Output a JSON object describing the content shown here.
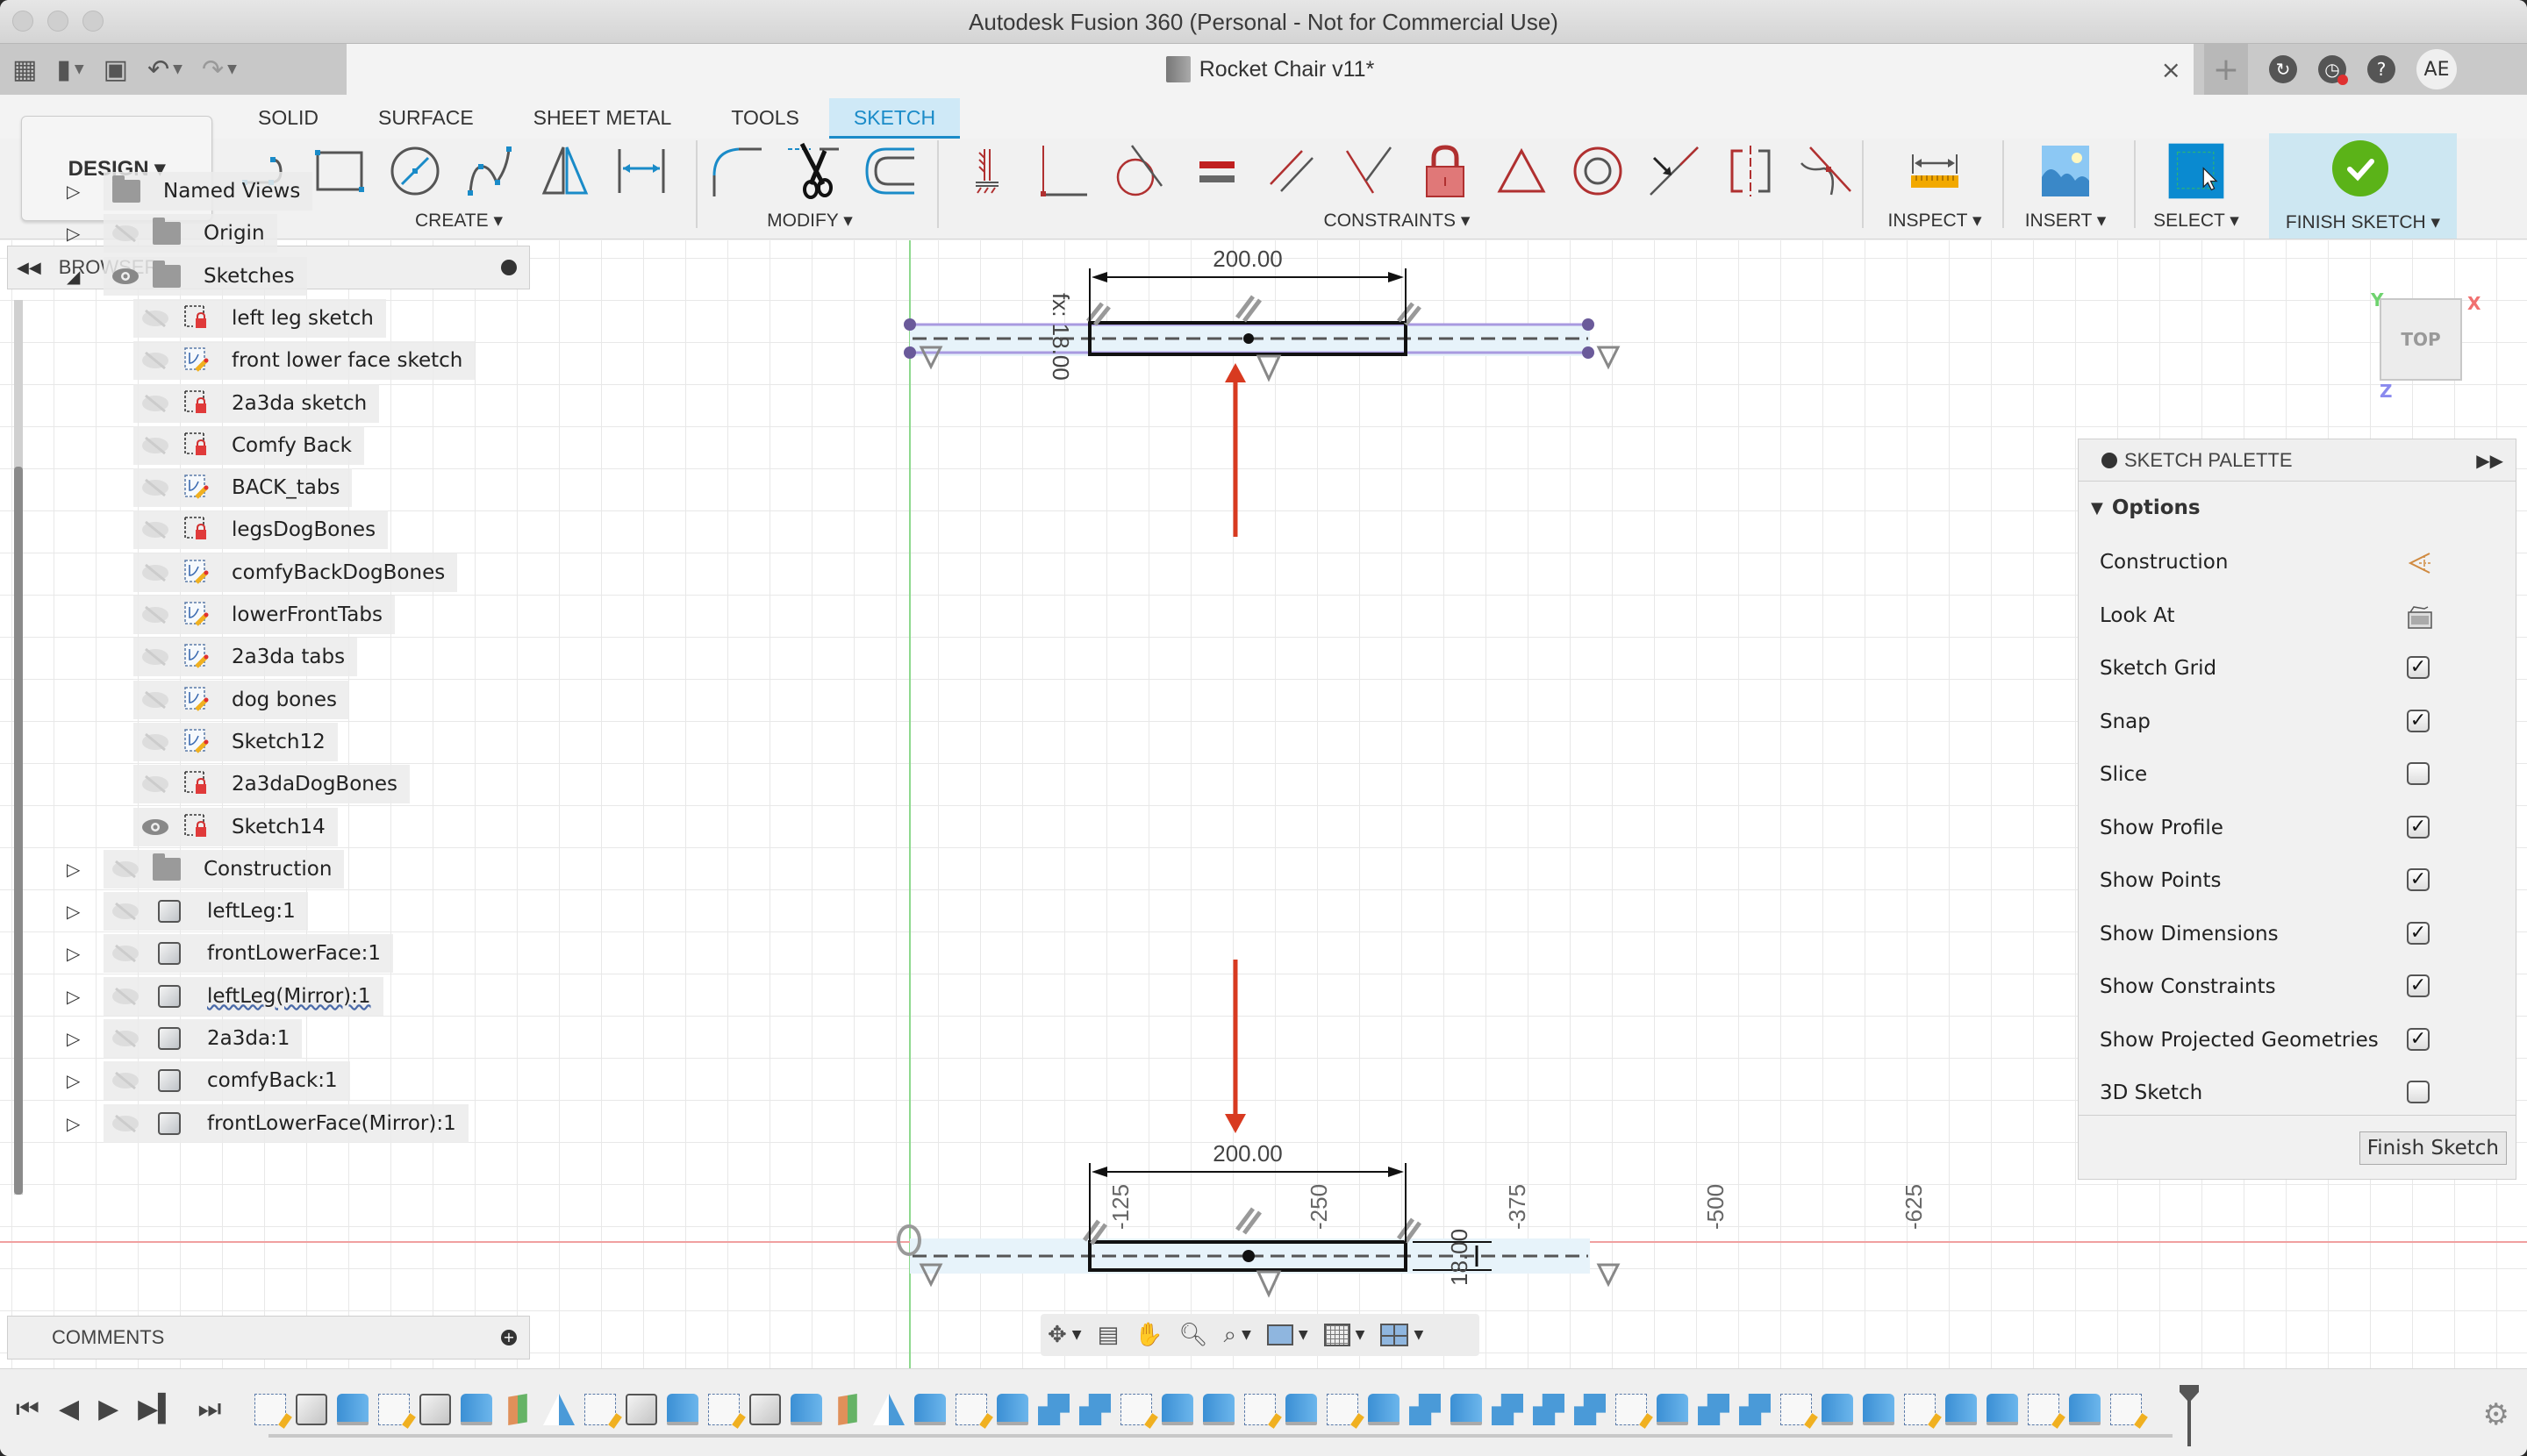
{
  "window": {
    "title": "Autodesk Fusion 360 (Personal - Not for Commercial Use)"
  },
  "quick_access": {
    "icons": [
      "app-grid-icon",
      "file-icon",
      "save-icon",
      "undo-icon",
      "redo-icon"
    ],
    "document_title": "Rocket Chair v11*",
    "close_label": "×",
    "right_icons": [
      "new-tab-plus-icon",
      "job-status-icon",
      "notifications-icon",
      "help-icon"
    ],
    "user_initials": "AE"
  },
  "ribbon": {
    "workspace": "DESIGN ▾",
    "tabs": [
      {
        "label": "SOLID",
        "active": false
      },
      {
        "label": "SURFACE",
        "active": false
      },
      {
        "label": "SHEET METAL",
        "active": false
      },
      {
        "label": "TOOLS",
        "active": false
      },
      {
        "label": "SKETCH",
        "active": true
      }
    ],
    "groups": {
      "create": {
        "label": "CREATE ▾",
        "tools": [
          "line",
          "rectangle",
          "circle",
          "spline",
          "mirror",
          "sketch-dimension"
        ]
      },
      "modify": {
        "label": "MODIFY ▾",
        "tools": [
          "fillet",
          "trim",
          "offset"
        ]
      },
      "constraints": {
        "label": "CONSTRAINTS ▾",
        "tools": [
          "fix",
          "perpendicular-coincident",
          "tangent",
          "equal",
          "parallel",
          "perpendicular",
          "lock",
          "triangle",
          "concentric",
          "midpoint",
          "symmetry",
          "curvature"
        ]
      },
      "inspect": {
        "label": "INSPECT ▾"
      },
      "insert": {
        "label": "INSERT ▾"
      },
      "select": {
        "label": "SELECT ▾"
      },
      "finish": {
        "label": "FINISH SKETCH ▾"
      }
    },
    "accent_color": "#1a8bc8"
  },
  "browser": {
    "title": "BROWSER",
    "items": [
      {
        "label": "Named Views",
        "type": "folder",
        "level": 0,
        "expanded": false,
        "visible": null
      },
      {
        "label": "Origin",
        "type": "folder",
        "level": 0,
        "expanded": false,
        "visible": false
      },
      {
        "label": "Sketches",
        "type": "folder",
        "level": 0,
        "expanded": true,
        "visible": true
      },
      {
        "label": "left leg sketch",
        "type": "sketch-locked",
        "level": 1,
        "visible": false
      },
      {
        "label": "front lower face sketch",
        "type": "sketch",
        "level": 1,
        "visible": false
      },
      {
        "label": "2a3da sketch",
        "type": "sketch-locked",
        "level": 1,
        "visible": false
      },
      {
        "label": "Comfy Back",
        "type": "sketch-locked",
        "level": 1,
        "visible": false
      },
      {
        "label": "BACK_tabs",
        "type": "sketch",
        "level": 1,
        "visible": false
      },
      {
        "label": "legsDogBones",
        "type": "sketch-locked",
        "level": 1,
        "visible": false
      },
      {
        "label": "comfyBackDogBones",
        "type": "sketch",
        "level": 1,
        "visible": false
      },
      {
        "label": "lowerFrontTabs",
        "type": "sketch",
        "level": 1,
        "visible": false
      },
      {
        "label": "2a3da tabs",
        "type": "sketch",
        "level": 1,
        "visible": false
      },
      {
        "label": "dog bones",
        "type": "sketch",
        "level": 1,
        "visible": false
      },
      {
        "label": "Sketch12",
        "type": "sketch",
        "level": 1,
        "visible": false
      },
      {
        "label": "2a3daDogBones",
        "type": "sketch-locked",
        "level": 1,
        "visible": false
      },
      {
        "label": "Sketch14",
        "type": "sketch-locked",
        "level": 1,
        "visible": true
      },
      {
        "label": "Construction",
        "type": "folder",
        "level": 0,
        "expanded": false,
        "visible": false
      },
      {
        "label": "leftLeg:1",
        "type": "body",
        "level": 0,
        "expanded": false,
        "visible": false
      },
      {
        "label": "frontLowerFace:1",
        "type": "body",
        "level": 0,
        "expanded": false,
        "visible": false
      },
      {
        "label": "leftLeg(Mirror):1",
        "type": "body",
        "level": 0,
        "expanded": false,
        "visible": false,
        "warning": true
      },
      {
        "label": "2a3da:1",
        "type": "body",
        "level": 0,
        "expanded": false,
        "visible": false
      },
      {
        "label": "comfyBack:1",
        "type": "body",
        "level": 0,
        "expanded": false,
        "visible": false
      },
      {
        "label": "frontLowerFace(Mirror):1",
        "type": "body",
        "level": 0,
        "expanded": false,
        "visible": false
      }
    ]
  },
  "comments": {
    "title": "COMMENTS"
  },
  "sketch_palette": {
    "title": "SKETCH PALETTE",
    "section": "Options",
    "options": [
      {
        "label": "Construction",
        "control": "icon",
        "icon": "construction-icon"
      },
      {
        "label": "Look At",
        "control": "icon",
        "icon": "look-at-icon"
      },
      {
        "label": "Sketch Grid",
        "control": "checkbox",
        "checked": true
      },
      {
        "label": "Snap",
        "control": "checkbox",
        "checked": true
      },
      {
        "label": "Slice",
        "control": "checkbox",
        "checked": false
      },
      {
        "label": "Show Profile",
        "control": "checkbox",
        "checked": true
      },
      {
        "label": "Show Points",
        "control": "checkbox",
        "checked": true
      },
      {
        "label": "Show Dimensions",
        "control": "checkbox",
        "checked": true
      },
      {
        "label": "Show Constraints",
        "control": "checkbox",
        "checked": true
      },
      {
        "label": "Show Projected Geometries",
        "control": "checkbox",
        "checked": true
      },
      {
        "label": "3D Sketch",
        "control": "checkbox",
        "checked": false
      }
    ],
    "finish_button": "Finish Sketch",
    "check_glyph": "✓"
  },
  "canvas": {
    "top_part": {
      "width_dim": "200.00",
      "height_dim": "fx: 18.00"
    },
    "bottom_part": {
      "width_dim": "200.00",
      "height_dim": "18.00"
    },
    "axis_labels": [
      "-125",
      "-250",
      "-375",
      "-500",
      "-625"
    ],
    "viewcube": {
      "face": "TOP",
      "x": "X",
      "y": "Y",
      "z": "Z"
    }
  },
  "navbar": {
    "tools": [
      "orbit-icon",
      "look-at-icon",
      "pan-icon",
      "zoom-icon",
      "fit-icon",
      "display-settings-icon",
      "grid-settings-icon",
      "viewports-icon"
    ]
  },
  "timeline": {
    "controls": [
      "⏮",
      "◀",
      "▶",
      "▶▍",
      "⏭"
    ],
    "items": [
      "sketch",
      "body",
      "ext",
      "sketch",
      "body",
      "ext",
      "plane",
      "mirror",
      "sketch",
      "body",
      "ext",
      "sketch",
      "body",
      "ext",
      "plane",
      "mirror",
      "ext",
      "sketch",
      "ext",
      "combine",
      "combine",
      "sketch",
      "ext",
      "ext",
      "sketch",
      "ext",
      "sketch",
      "ext",
      "combine",
      "ext",
      "combine",
      "combine",
      "combine",
      "sketch",
      "ext",
      "combine",
      "combine",
      "sketch",
      "ext",
      "ext",
      "sketch",
      "ext",
      "ext",
      "sketch",
      "ext",
      "sketch"
    ],
    "settings_icon": "⚙"
  }
}
